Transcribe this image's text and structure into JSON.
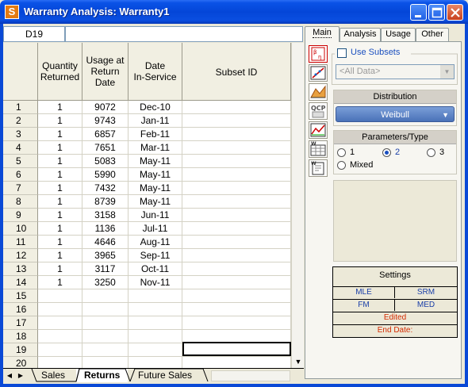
{
  "window": {
    "app_icon": "S",
    "title": "Warranty Analysis: Warranty1"
  },
  "sheet": {
    "cell_ref": "D19",
    "formula_value": "",
    "headers": [
      "Quantity\nReturned",
      "Usage at\nReturn\nDate",
      "Date\nIn-Service",
      "Subset ID"
    ],
    "rows": [
      {
        "n": "1",
        "qty": "1",
        "usage": "9072",
        "date": "Dec-10",
        "subset": ""
      },
      {
        "n": "2",
        "qty": "1",
        "usage": "9743",
        "date": "Jan-11",
        "subset": ""
      },
      {
        "n": "3",
        "qty": "1",
        "usage": "6857",
        "date": "Feb-11",
        "subset": ""
      },
      {
        "n": "4",
        "qty": "1",
        "usage": "7651",
        "date": "Mar-11",
        "subset": ""
      },
      {
        "n": "5",
        "qty": "1",
        "usage": "5083",
        "date": "May-11",
        "subset": ""
      },
      {
        "n": "6",
        "qty": "1",
        "usage": "5990",
        "date": "May-11",
        "subset": ""
      },
      {
        "n": "7",
        "qty": "1",
        "usage": "7432",
        "date": "May-11",
        "subset": ""
      },
      {
        "n": "8",
        "qty": "1",
        "usage": "8739",
        "date": "May-11",
        "subset": ""
      },
      {
        "n": "9",
        "qty": "1",
        "usage": "3158",
        "date": "Jun-11",
        "subset": ""
      },
      {
        "n": "10",
        "qty": "1",
        "usage": "1136",
        "date": "Jul-11",
        "subset": ""
      },
      {
        "n": "11",
        "qty": "1",
        "usage": "4646",
        "date": "Aug-11",
        "subset": ""
      },
      {
        "n": "12",
        "qty": "1",
        "usage": "3965",
        "date": "Sep-11",
        "subset": ""
      },
      {
        "n": "13",
        "qty": "1",
        "usage": "3117",
        "date": "Oct-11",
        "subset": ""
      },
      {
        "n": "14",
        "qty": "1",
        "usage": "3250",
        "date": "Nov-11",
        "subset": ""
      },
      {
        "n": "15",
        "qty": "",
        "usage": "",
        "date": "",
        "subset": ""
      },
      {
        "n": "16",
        "qty": "",
        "usage": "",
        "date": "",
        "subset": ""
      },
      {
        "n": "17",
        "qty": "",
        "usage": "",
        "date": "",
        "subset": ""
      },
      {
        "n": "18",
        "qty": "",
        "usage": "",
        "date": "",
        "subset": ""
      },
      {
        "n": "19",
        "qty": "",
        "usage": "",
        "date": "",
        "subset": ""
      },
      {
        "n": "20",
        "qty": "",
        "usage": "",
        "date": "",
        "subset": ""
      }
    ],
    "selected_cell": "D19",
    "tabs": [
      "Sales",
      "Returns",
      "Future Sales"
    ],
    "active_tab": "Returns"
  },
  "panel": {
    "tabs": [
      "Main",
      "Analysis",
      "Usage",
      "Other"
    ],
    "active_tab": "Main",
    "use_subsets_label": "Use Subsets",
    "use_subsets_checked": false,
    "subset_combo_value": "<All Data>",
    "distribution_title": "Distribution",
    "distribution_value": "Weibull",
    "params_title": "Parameters/Type",
    "params": [
      {
        "label": "1",
        "checked": false
      },
      {
        "label": "2",
        "checked": true
      },
      {
        "label": "3",
        "checked": false
      },
      {
        "label": "Mixed",
        "checked": false
      }
    ],
    "settings": {
      "title": "Settings",
      "mle": "MLE",
      "srm": "SRM",
      "fm": "FM",
      "med": "MED",
      "edited": "Edited",
      "end_date": "End Date:"
    },
    "colors": {
      "accent_blue": "#1a3fa8",
      "accent_red": "#d42a00",
      "title_bar": "#0446d8"
    }
  }
}
